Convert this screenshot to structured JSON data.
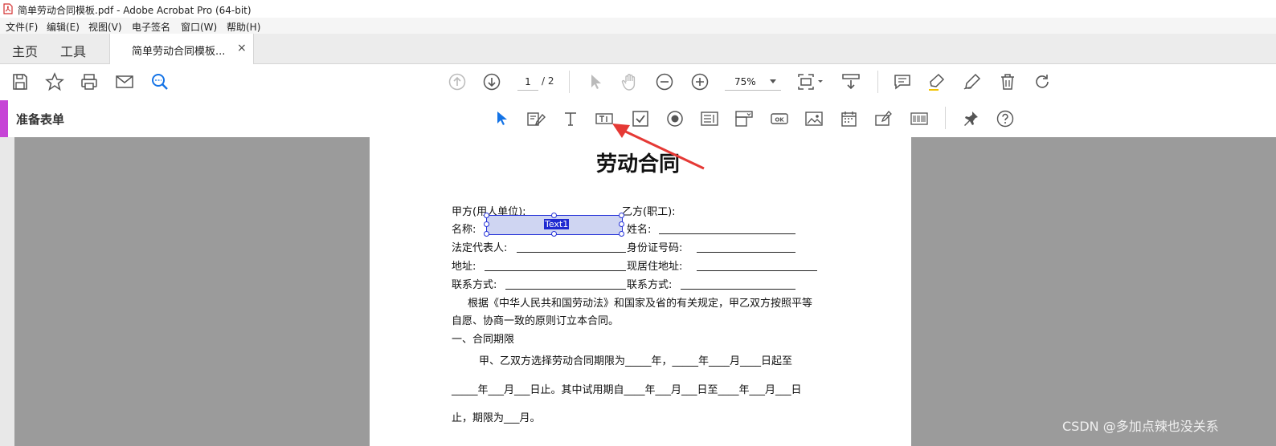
{
  "window": {
    "title": "简单劳动合同模板.pdf - Adobe Acrobat Pro (64-bit)"
  },
  "menu": [
    "文件(F)",
    "编辑(E)",
    "视图(V)",
    "电子签名",
    "窗口(W)",
    "帮助(H)"
  ],
  "nav_tabs": {
    "home": "主页",
    "tools": "工具",
    "document": "简单劳动合同模板...",
    "close": "×"
  },
  "toolbar": {
    "page_current": "1",
    "page_total": "/ 2",
    "zoom": "75%"
  },
  "form_toolbar": {
    "title": "准备表单"
  },
  "document": {
    "title": "劳动合同",
    "lines": {
      "party_a": "甲方(用人单位):",
      "party_b": "乙方(职工):",
      "name_a": "名称:",
      "name_b": "姓名:",
      "legal_rep": "法定代表人:",
      "id_no": "身份证号码:",
      "address": "地址:",
      "current_address": "现居住地址:",
      "contact_a": "联系方式:",
      "contact_b": "联系方式:",
      "para1": "根据《中华人民共和国劳动法》和国家及省的有关规定，甲乙双方按照平等",
      "para2": "自愿、协商一致的原则订立本合同。",
      "section1": "一、合同期限",
      "term1": "甲、乙双方选择劳动合同期限为_____年，_____年____月____日起至",
      "term2": "_____年___月___日止。其中试用期自____年___月___日至____年___月___日",
      "term3": "止，期限为___月。"
    },
    "field_label": "Text1"
  },
  "watermark": "CSDN @多加点辣也没关系",
  "colors": {
    "accent": "#c644d6",
    "field_border": "#2431d8",
    "arrow": "#e53935"
  }
}
